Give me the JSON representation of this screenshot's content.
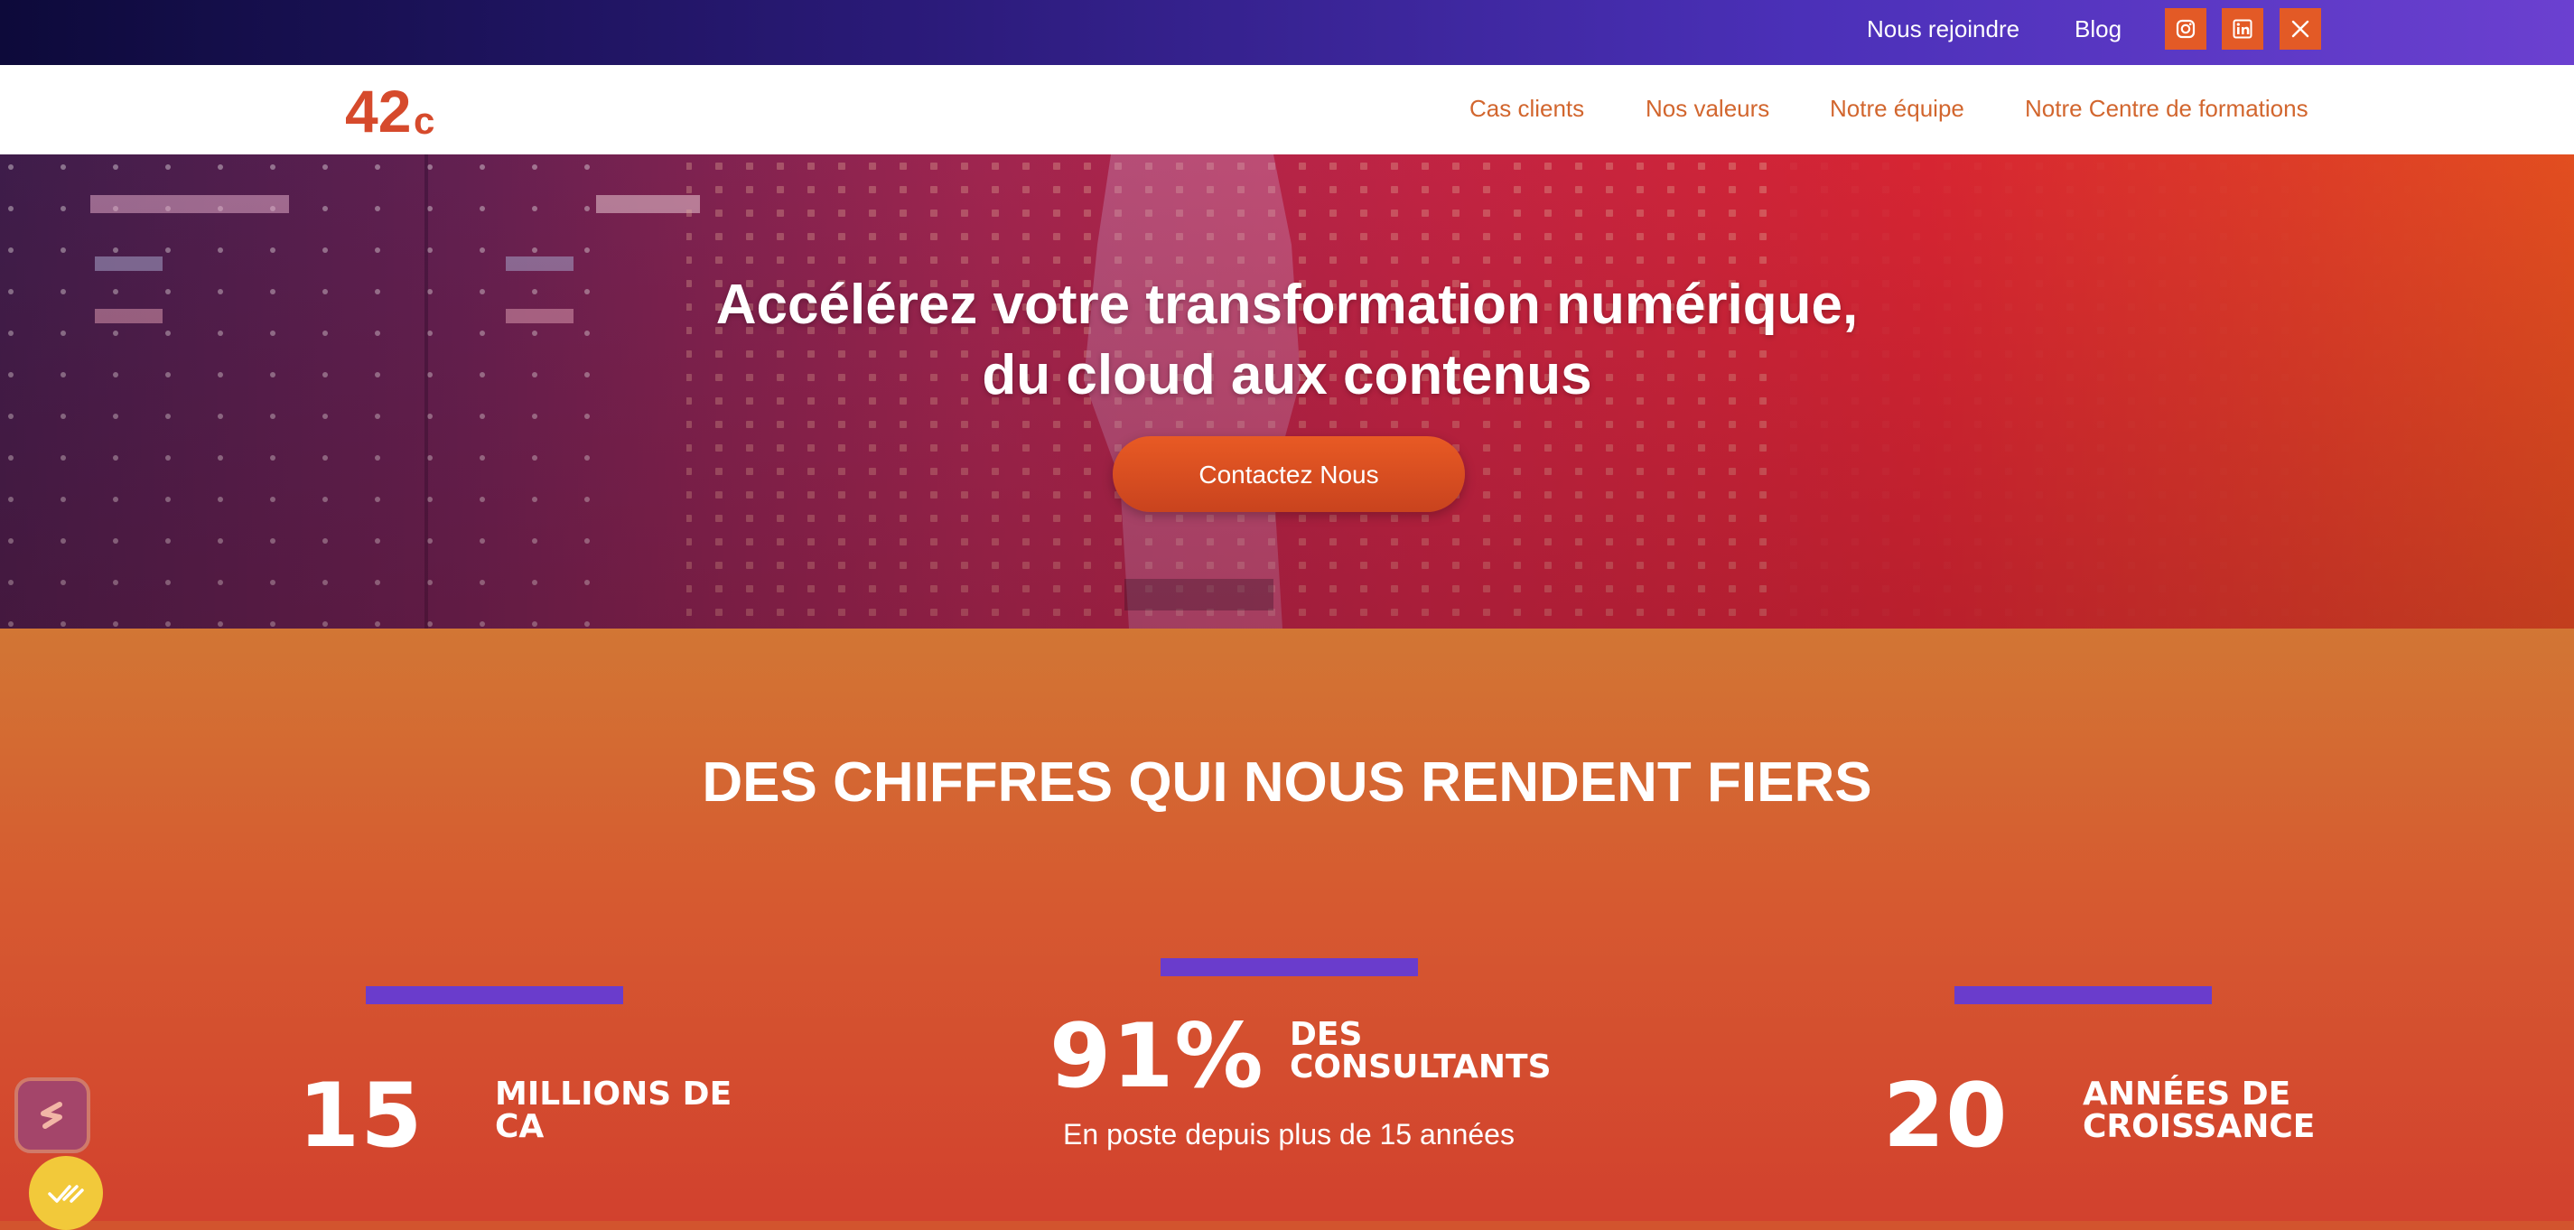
{
  "topbar": {
    "links": {
      "join": "Nous rejoindre",
      "blog": "Blog"
    },
    "social": [
      "instagram-icon",
      "linkedin-icon",
      "x-icon"
    ],
    "social_color": "#e35a26"
  },
  "nav": {
    "logo": {
      "number": "42",
      "letter": "c"
    },
    "items": [
      {
        "label": "Cas clients"
      },
      {
        "label": "Nos valeurs"
      },
      {
        "label": "Notre équipe"
      },
      {
        "label": "Notre Centre de formations"
      }
    ],
    "link_color": "#d2662e"
  },
  "hero": {
    "title_line1": "Accélérez votre transformation numérique,",
    "title_line2": "du cloud aux contenus",
    "cta": "Contactez Nous"
  },
  "stats": {
    "heading": "DES CHIFFRES QUI NOUS RENDENT FIERS",
    "accent_color": "#6a3ccc",
    "items": [
      {
        "value": "15",
        "label": "MILLIONS DE\nCA"
      },
      {
        "value": "91%",
        "label": "DES\nCONSULTANTS",
        "sub": "En poste depuis plus de 15 années"
      },
      {
        "value": "20",
        "label": "ANNÉES DE\nCROISSANCE"
      }
    ]
  }
}
